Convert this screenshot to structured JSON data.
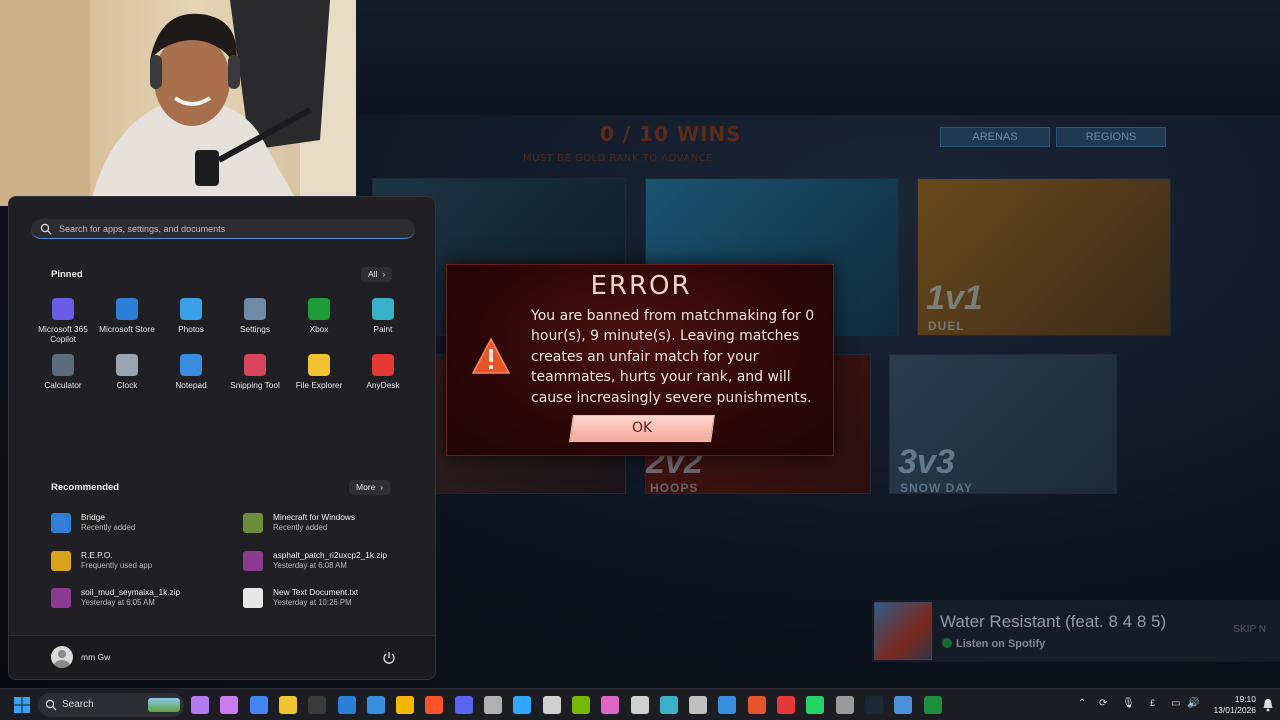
{
  "game": {
    "wins_text": "0 / 10 WINS",
    "wins_subtext": "MUST BE GOLD RANK TO ADVANCE",
    "tabs": [
      "ARENAS",
      "REGIONS"
    ],
    "tiles": [
      {
        "label": "",
        "sub": ""
      },
      {
        "label": "",
        "sub": ""
      },
      {
        "label": "1v1",
        "sub": "DUEL"
      },
      {
        "label": "",
        "sub": ""
      },
      {
        "label": "2v2",
        "sub": "HOOPS"
      },
      {
        "label": "3v3",
        "sub": "SNOW DAY"
      }
    ]
  },
  "error_dialog": {
    "title": "ERROR",
    "message": "You are banned from matchmaking for 0 hour(s), 9 minute(s). Leaving matches creates an unfair match for your teammates, hurts your rank, and will cause increasingly severe punishments.",
    "ok_label": "OK",
    "warning_color": "#e8552a"
  },
  "spotify": {
    "song": "Water Resistant (feat. 8 4 8 5)",
    "listen": "Listen on Spotify",
    "skip": "SKIP N"
  },
  "start_menu": {
    "search_placeholder": "Search for apps, settings, and documents",
    "pinned_title": "Pinned",
    "all_button": "All",
    "pinned_apps": [
      {
        "name": "Microsoft 365 Copilot",
        "icon": "copilot-icon",
        "color": "#6b5ce7"
      },
      {
        "name": "Microsoft Store",
        "icon": "store-icon",
        "color": "#2b7fd8"
      },
      {
        "name": "Photos",
        "icon": "photos-icon",
        "color": "#3aa0e8"
      },
      {
        "name": "Settings",
        "icon": "gear-icon",
        "color": "#6d8aa6"
      },
      {
        "name": "Xbox",
        "icon": "xbox-icon",
        "color": "#1f9c3a"
      },
      {
        "name": "Paint",
        "icon": "paint-icon",
        "color": "#3bb0c9"
      },
      {
        "name": "Calculator",
        "icon": "calculator-icon",
        "color": "#5a6b7c"
      },
      {
        "name": "Clock",
        "icon": "clock-icon",
        "color": "#9aa5b1"
      },
      {
        "name": "Notepad",
        "icon": "notepad-icon",
        "color": "#3a8ee0"
      },
      {
        "name": "Snipping Tool",
        "icon": "snipping-tool-icon",
        "color": "#d9455b"
      },
      {
        "name": "File Explorer",
        "icon": "folder-icon",
        "color": "#f1c232"
      },
      {
        "name": "AnyDesk",
        "icon": "anydesk-icon",
        "color": "#e53935"
      }
    ],
    "recommended_title": "Recommended",
    "more_button": "More",
    "recommended": [
      {
        "name": "Bridge",
        "detail": "Recently added",
        "icon": "bridge-icon",
        "color": "#2f7fd6"
      },
      {
        "name": "Minecraft for Windows",
        "detail": "Recently added",
        "icon": "minecraft-icon",
        "color": "#6b8e3a"
      },
      {
        "name": "R.E.P.O.",
        "detail": "Frequently used app",
        "icon": "repo-icon",
        "color": "#d9a21b"
      },
      {
        "name": "asphalt_patch_ri2uxcp2_1k.zip",
        "detail": "Yesterday at 6:08 AM",
        "icon": "zip-icon",
        "color": "#8a3b8f"
      },
      {
        "name": "soil_mud_seymaixa_1k.zip",
        "detail": "Yesterday at 6:05 AM",
        "icon": "zip-icon",
        "color": "#8a3b8f"
      },
      {
        "name": "New Text Document.txt",
        "detail": "Yesterday at 10:26 PM",
        "icon": "text-file-icon",
        "color": "#e8e8e8"
      }
    ],
    "user_name": "mm Gw"
  },
  "taskbar": {
    "search_label": "Search",
    "apps": [
      {
        "name": "ai-assistant-icon",
        "color": "#b07cf0"
      },
      {
        "name": "app-dots-icon",
        "color": "#c97cf0"
      },
      {
        "name": "chrome-icon",
        "color": "#4285f4"
      },
      {
        "name": "file-explorer-icon",
        "color": "#f1c232"
      },
      {
        "name": "epic-games-icon",
        "color": "#3a3a3a"
      },
      {
        "name": "store-icon",
        "color": "#2b7fd8"
      },
      {
        "name": "notepad-icon",
        "color": "#3a8ee0"
      },
      {
        "name": "rockstar-icon",
        "color": "#f5b800"
      },
      {
        "name": "brave-icon",
        "color": "#fb542b"
      },
      {
        "name": "discord-icon",
        "color": "#5865f2"
      },
      {
        "name": "obs-icon",
        "color": "#b0b0b0"
      },
      {
        "name": "photoshop-icon",
        "color": "#31a8ff"
      },
      {
        "name": "steam-link-icon",
        "color": "#d0d0d0"
      },
      {
        "name": "nvidia-icon",
        "color": "#76b900"
      },
      {
        "name": "app-pink-icon",
        "color": "#e066c6"
      },
      {
        "name": "capcut-icon",
        "color": "#d0d0d0"
      },
      {
        "name": "browser-icon",
        "color": "#3bb0c9"
      },
      {
        "name": "mail-icon",
        "color": "#c0c0c0"
      },
      {
        "name": "paper-icon",
        "color": "#3a8ee0"
      },
      {
        "name": "acrobat-icon",
        "color": "#e8552a"
      },
      {
        "name": "autodesk-icon",
        "color": "#e53935"
      },
      {
        "name": "whatsapp-icon",
        "color": "#25d366"
      },
      {
        "name": "tool-icon",
        "color": "#9a9a9a"
      },
      {
        "name": "steam-icon",
        "color": "#1b2838"
      },
      {
        "name": "shield-icon",
        "color": "#4a90d9"
      },
      {
        "name": "sheets-icon",
        "color": "#1e8e3e"
      }
    ],
    "tray_lang": "£",
    "time": "19:10",
    "date": "13/01/2026"
  }
}
